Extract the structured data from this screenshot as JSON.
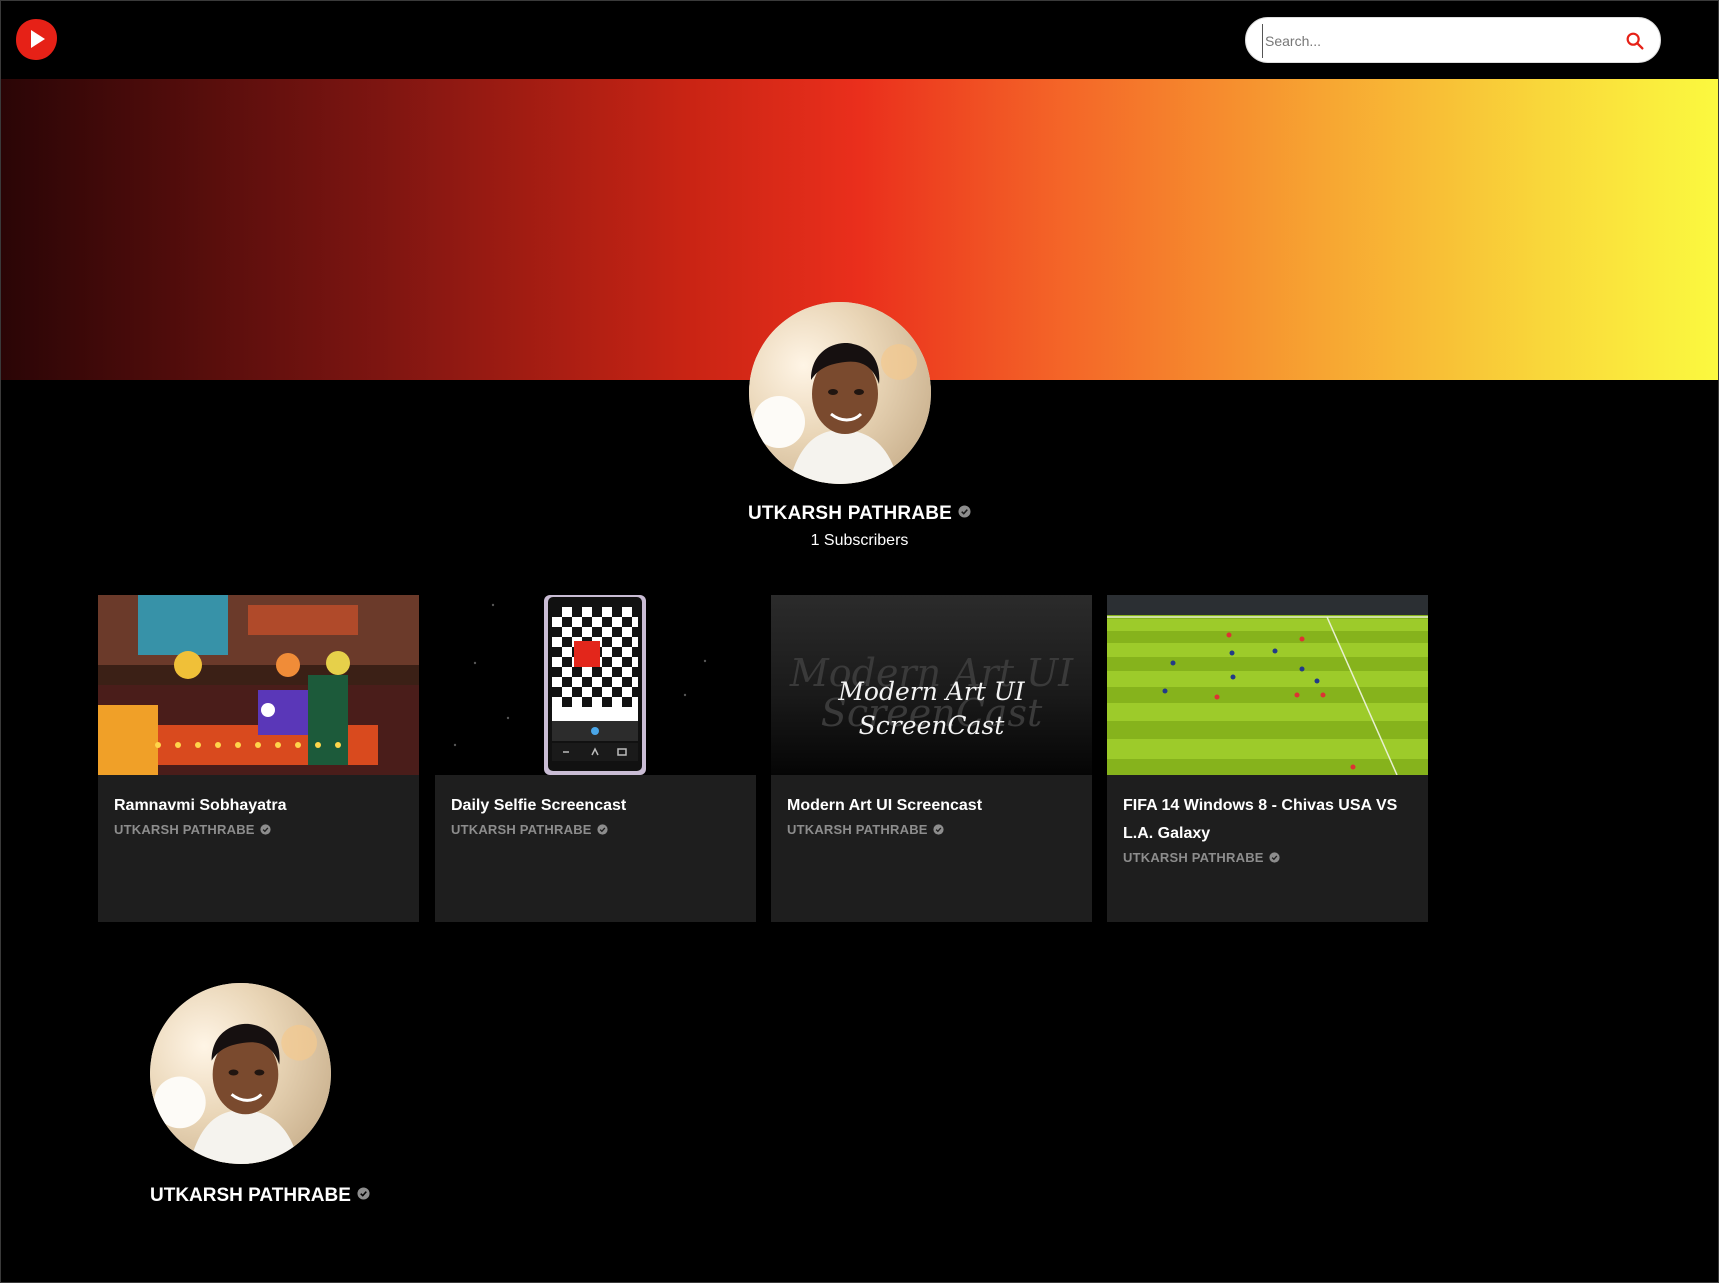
{
  "header": {
    "logo_icon": "play-logo-icon",
    "search": {
      "placeholder": "Search...",
      "value": ""
    },
    "search_icon": "search-icon",
    "accent": "#e62117"
  },
  "banner": {
    "colors": [
      "#2a0506",
      "#ea2f1c",
      "#fbf93f"
    ]
  },
  "channel": {
    "name": "UTKARSH PATHRABE",
    "subscribers": "1 Subscribers",
    "verified_icon": "verified-icon"
  },
  "videos": [
    {
      "title": "Ramnavmi Sobhayatra",
      "channel": "UTKARSH PATHRABE"
    },
    {
      "title": "Daily Selfie Screencast",
      "channel": "UTKARSH PATHRABE"
    },
    {
      "title": "Modern Art UI Screencast",
      "channel": "UTKARSH PATHRABE",
      "thumb_text": [
        "Modern Art UI",
        "ScreenCast"
      ]
    },
    {
      "title": "FIFA 14 Windows 8 - Chivas USA VS L.A. Galaxy",
      "channel": "UTKARSH PATHRABE"
    }
  ],
  "profile": {
    "name": "UTKARSH PATHRABE"
  }
}
